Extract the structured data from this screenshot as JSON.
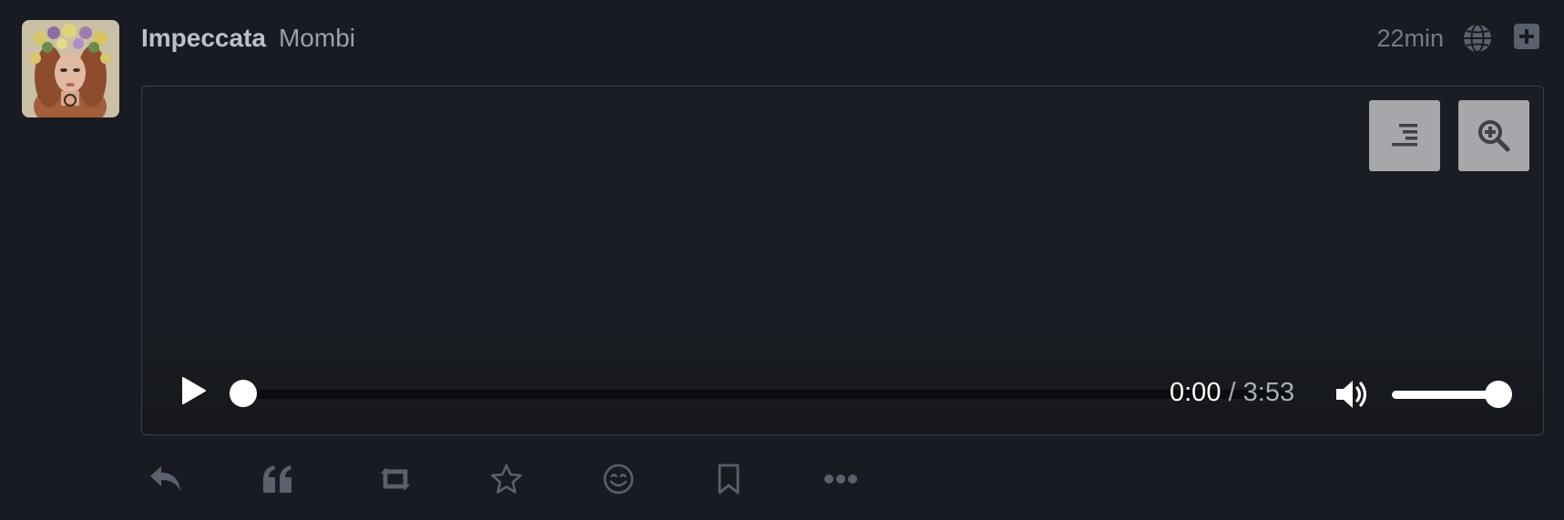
{
  "status": {
    "author": {
      "display_name": "Impeccata",
      "handle": "Mombi",
      "avatar_icon": "avatar-image"
    },
    "timestamp": "22min",
    "visibility_icon": "globe-icon",
    "expand_icon": "plus-square-icon"
  },
  "audio_player": {
    "current_time": "0:00",
    "separator": "/",
    "duration": "3:53",
    "progress": 0.0,
    "volume": 0.9,
    "buttons": [
      "transcript-icon",
      "zoom-in-icon"
    ]
  },
  "actions": [
    {
      "name": "reply",
      "icon": "reply-icon"
    },
    {
      "name": "quote",
      "icon": "quote-icon"
    },
    {
      "name": "boost",
      "icon": "retweet-icon"
    },
    {
      "name": "favourite",
      "icon": "star-icon"
    },
    {
      "name": "react",
      "icon": "smile-icon"
    },
    {
      "name": "bookmark",
      "icon": "bookmark-icon"
    },
    {
      "name": "more",
      "icon": "more-icon"
    }
  ],
  "colors": {
    "background": "#191b22",
    "icon": "#5a606c",
    "text_muted": "#757b86"
  }
}
